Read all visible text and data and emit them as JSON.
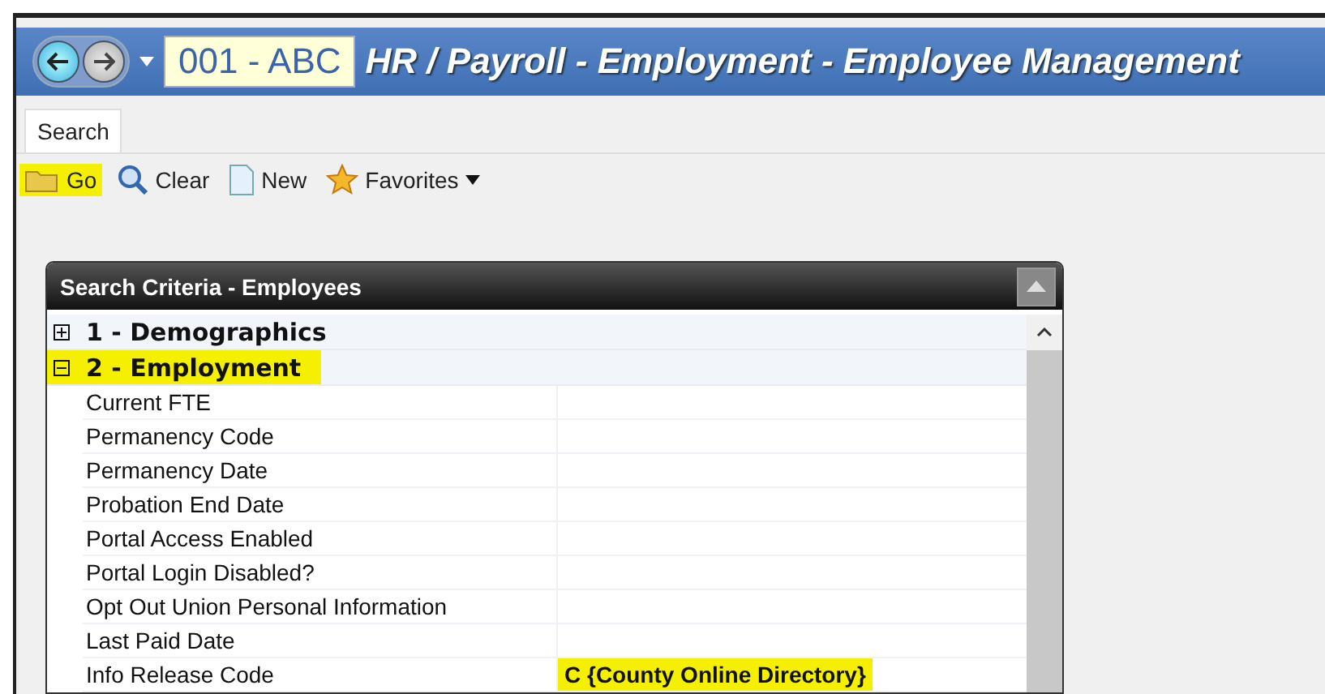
{
  "header": {
    "company": "001 - ABC",
    "title": "HR / Payroll - Employment - Employee Management"
  },
  "tabs": [
    {
      "label": "Search",
      "selected": true
    }
  ],
  "toolbar": [
    {
      "kind": "go",
      "label": "Go",
      "highlighted": true
    },
    {
      "kind": "clear",
      "label": "Clear",
      "highlighted": false
    },
    {
      "kind": "new",
      "label": "New",
      "highlighted": false
    },
    {
      "kind": "favorites",
      "label": "Favorites",
      "highlighted": false
    }
  ],
  "panel": {
    "title": "Search Criteria - Employees",
    "sections": [
      {
        "label": "1 - Demographics",
        "expanded": false,
        "highlighted": false
      },
      {
        "label": "2 - Employment",
        "expanded": true,
        "highlighted": true,
        "fields": [
          {
            "label": "Current FTE"
          },
          {
            "label": "Permanency Code"
          },
          {
            "label": "Permanency Date"
          },
          {
            "label": "Probation End Date"
          },
          {
            "label": "Portal Access Enabled"
          },
          {
            "label": "Portal Login Disabled?"
          },
          {
            "label": "Opt Out Union Personal Information"
          },
          {
            "label": "Last Paid Date"
          },
          {
            "label": "Info Release Code",
            "value": "C {County Online Directory}",
            "highlighted": true
          }
        ]
      }
    ]
  }
}
